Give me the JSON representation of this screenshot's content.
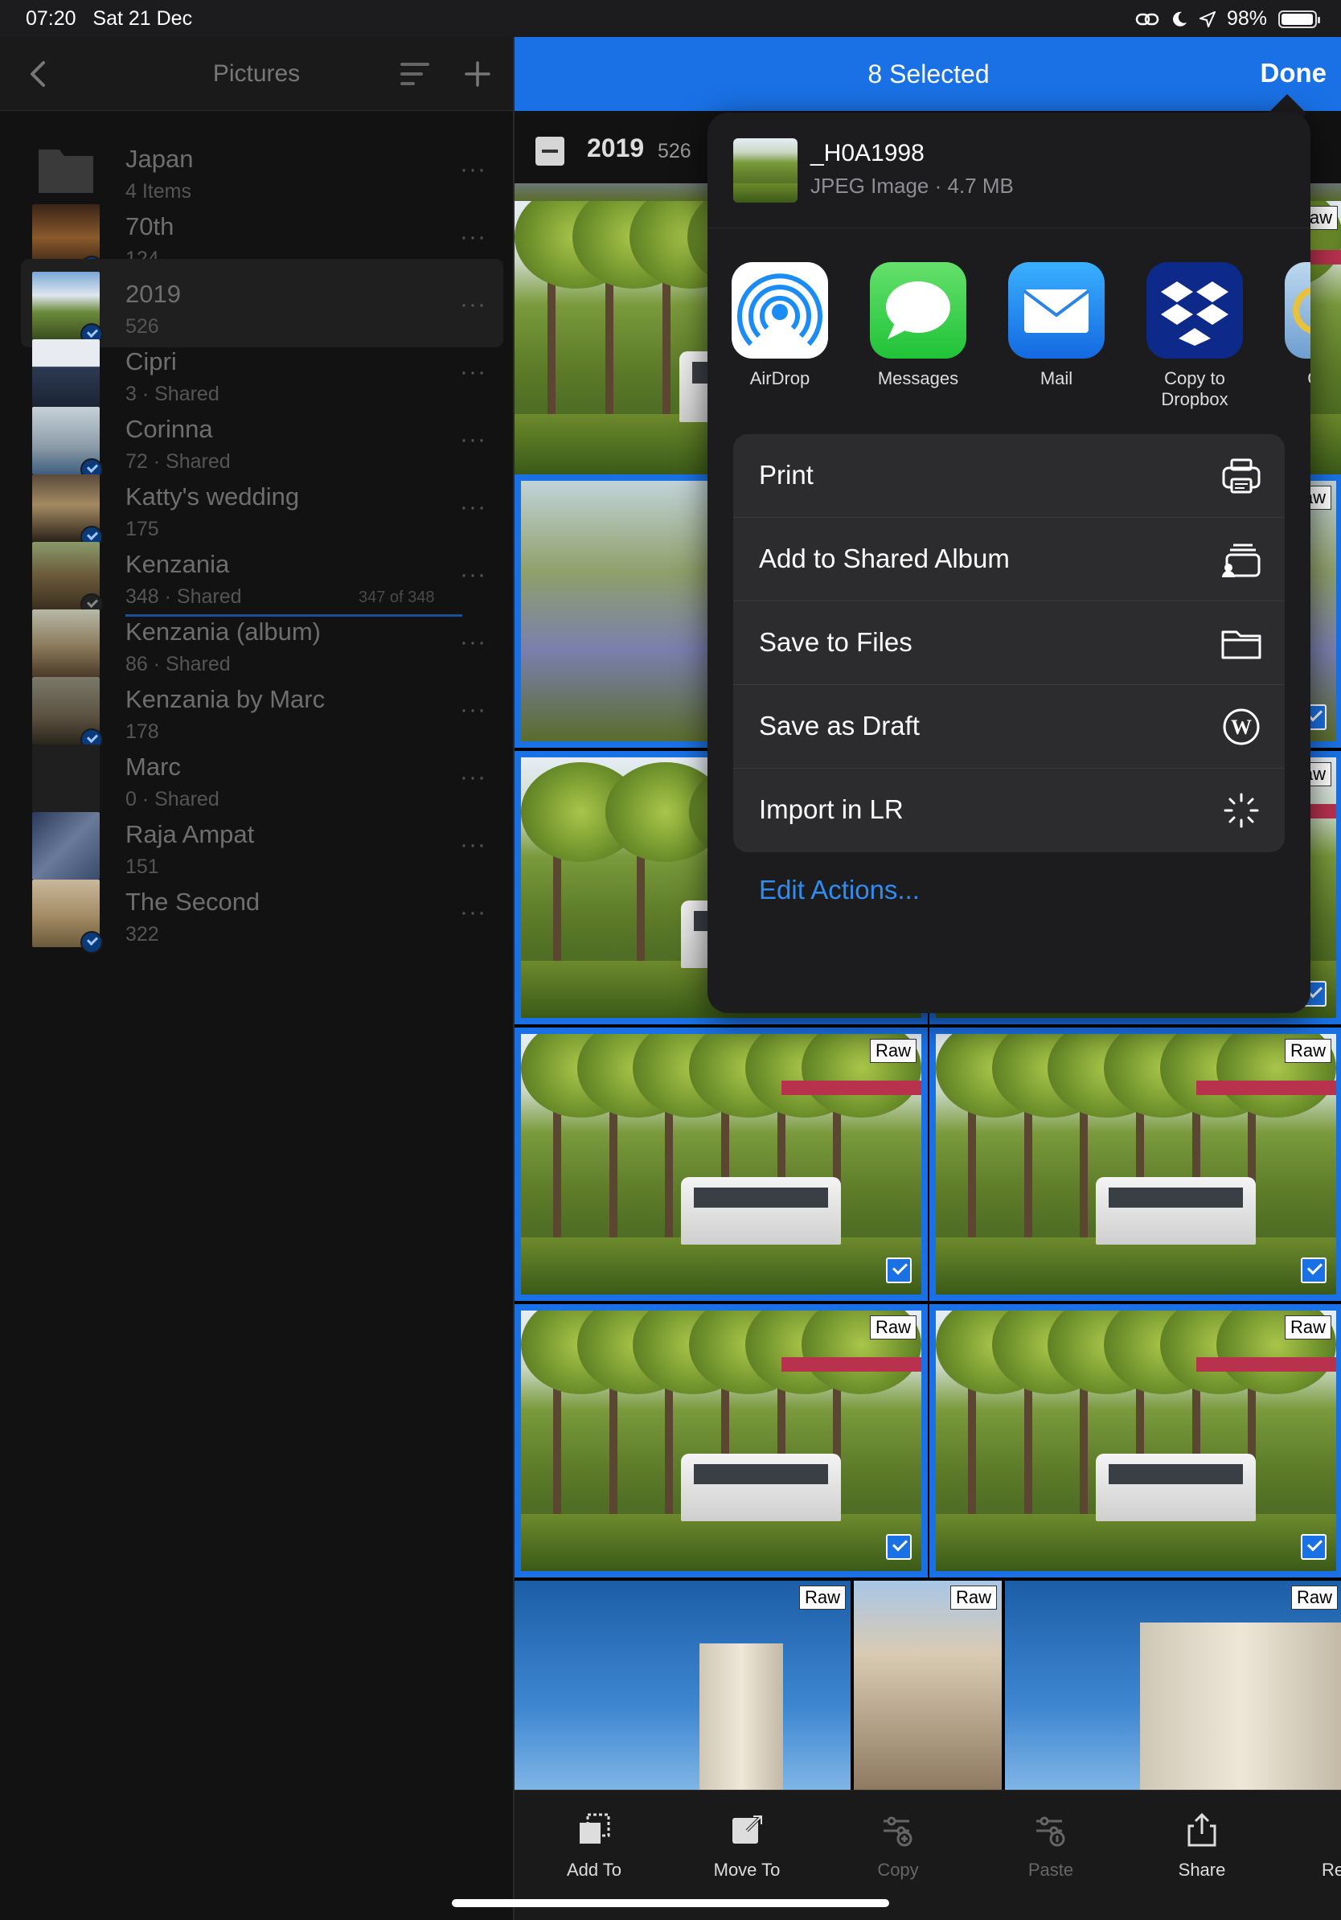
{
  "status": {
    "time": "07:20",
    "date": "Sat 21 Dec",
    "battery": "98%",
    "battery_level": 0.98
  },
  "sidebar": {
    "title": "Pictures",
    "albums": [
      {
        "name": "Japan",
        "meta": "4 Items"
      },
      {
        "name": "70th",
        "meta": "124"
      },
      {
        "name": "2019",
        "meta": "526"
      },
      {
        "name": "Cipri",
        "meta": "3 · Shared"
      },
      {
        "name": "Corinna",
        "meta": "72 · Shared"
      },
      {
        "name": "Katty's wedding",
        "meta": "175"
      },
      {
        "name": "Kenzania",
        "meta": "348 · Shared",
        "progress": "347 of 348",
        "progress_fraction": 0.997
      },
      {
        "name": "Kenzania (album)",
        "meta": "86 · Shared"
      },
      {
        "name": "Kenzania by Marc",
        "meta": "178"
      },
      {
        "name": "Marc",
        "meta": "0 · Shared"
      },
      {
        "name": "Raja Ampat",
        "meta": "151"
      },
      {
        "name": "The Second",
        "meta": "322"
      }
    ],
    "more_glyph": "···"
  },
  "header": {
    "selected_title": "8 Selected",
    "done_label": "Done",
    "accent_color": "#1a71e5"
  },
  "grid": {
    "year": "2019",
    "count": "526",
    "raw_label": "Raw"
  },
  "share": {
    "file_name": "_H0A1998",
    "file_info": "JPEG Image · 4.7 MB",
    "apps": [
      {
        "label": "AirDrop",
        "icon": "airdrop-icon"
      },
      {
        "label": "Messages",
        "icon": "messages-icon"
      },
      {
        "label": "Mail",
        "icon": "mail-icon"
      },
      {
        "label": "Copy to Dropbox",
        "icon": "dropbox-icon"
      },
      {
        "label": "C FTP",
        "icon": "ftp-icon"
      }
    ],
    "actions": [
      {
        "label": "Print",
        "icon": "printer-icon"
      },
      {
        "label": "Add to Shared Album",
        "icon": "shared-album-icon"
      },
      {
        "label": "Save to Files",
        "icon": "folder-icon"
      },
      {
        "label": "Save as Draft",
        "icon": "wordpress-icon"
      },
      {
        "label": "Import in LR",
        "icon": "sparkle-icon"
      }
    ],
    "edit_actions": "Edit Actions..."
  },
  "toolbar": {
    "items": [
      {
        "label": "Add To",
        "enabled": true
      },
      {
        "label": "Move To",
        "enabled": true
      },
      {
        "label": "Copy",
        "enabled": false
      },
      {
        "label": "Paste",
        "enabled": false
      },
      {
        "label": "Share",
        "enabled": true
      },
      {
        "label": "Remove",
        "enabled": true
      }
    ]
  }
}
